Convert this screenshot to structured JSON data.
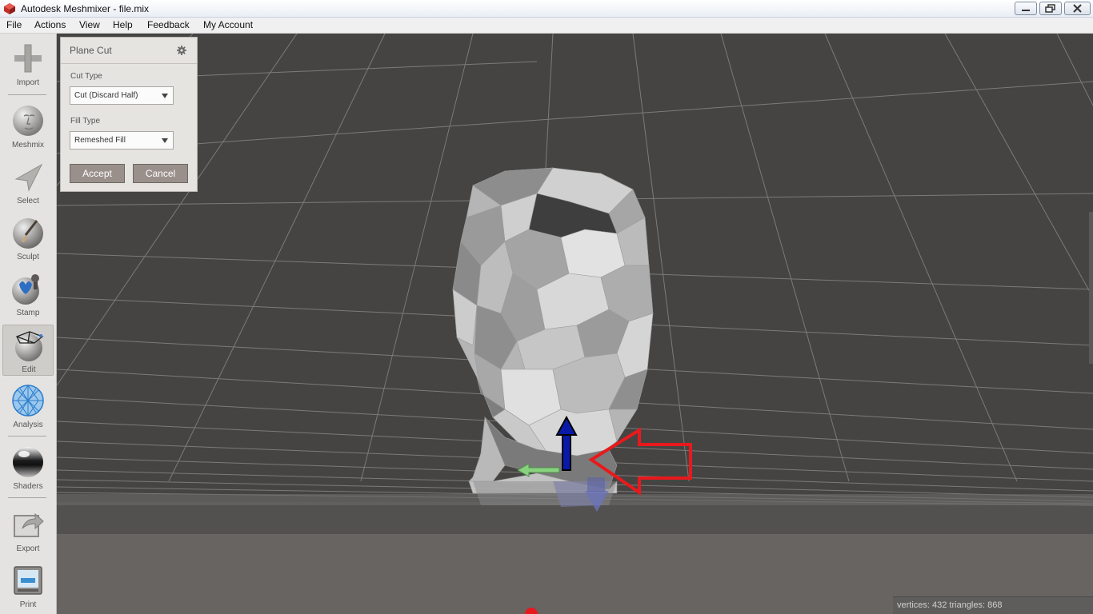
{
  "window": {
    "title": "Autodesk Meshmixer - file.mix"
  },
  "menubar": {
    "items": [
      {
        "label": "File"
      },
      {
        "label": "Actions"
      },
      {
        "label": "View"
      },
      {
        "label": "Help"
      },
      {
        "label": "Feedback"
      },
      {
        "label": "My Account"
      }
    ]
  },
  "toolbar": {
    "tools": [
      {
        "label": "Import",
        "icon": "plus-icon"
      },
      {
        "label": "Meshmix",
        "icon": "face-ball-icon"
      },
      {
        "label": "Select",
        "icon": "select-arrow-icon"
      },
      {
        "label": "Sculpt",
        "icon": "brush-ball-icon"
      },
      {
        "label": "Stamp",
        "icon": "stamp-icon"
      },
      {
        "label": "Edit",
        "icon": "edit-mesh-icon",
        "active": true
      },
      {
        "label": "Analysis",
        "icon": "analysis-mesh-icon"
      },
      {
        "label": "Shaders",
        "icon": "chrome-sphere-icon"
      },
      {
        "label": "Export",
        "icon": "export-icon"
      },
      {
        "label": "Print",
        "icon": "printer-icon"
      }
    ]
  },
  "panel": {
    "title": "Plane Cut",
    "cut_type_label": "Cut Type",
    "cut_type_value": "Cut (Discard Half)",
    "fill_type_label": "Fill Type",
    "fill_type_value": "Remeshed Fill",
    "accept_label": "Accept",
    "cancel_label": "Cancel"
  },
  "status": {
    "text": "vertices: 432 triangles: 868"
  },
  "colors": {
    "viewport": "#454443",
    "floor": "#676462",
    "gizmo_up": "#0a1aa8",
    "gizmo_side": "#7fc97a",
    "annotation_arrow": "#e8191c"
  }
}
